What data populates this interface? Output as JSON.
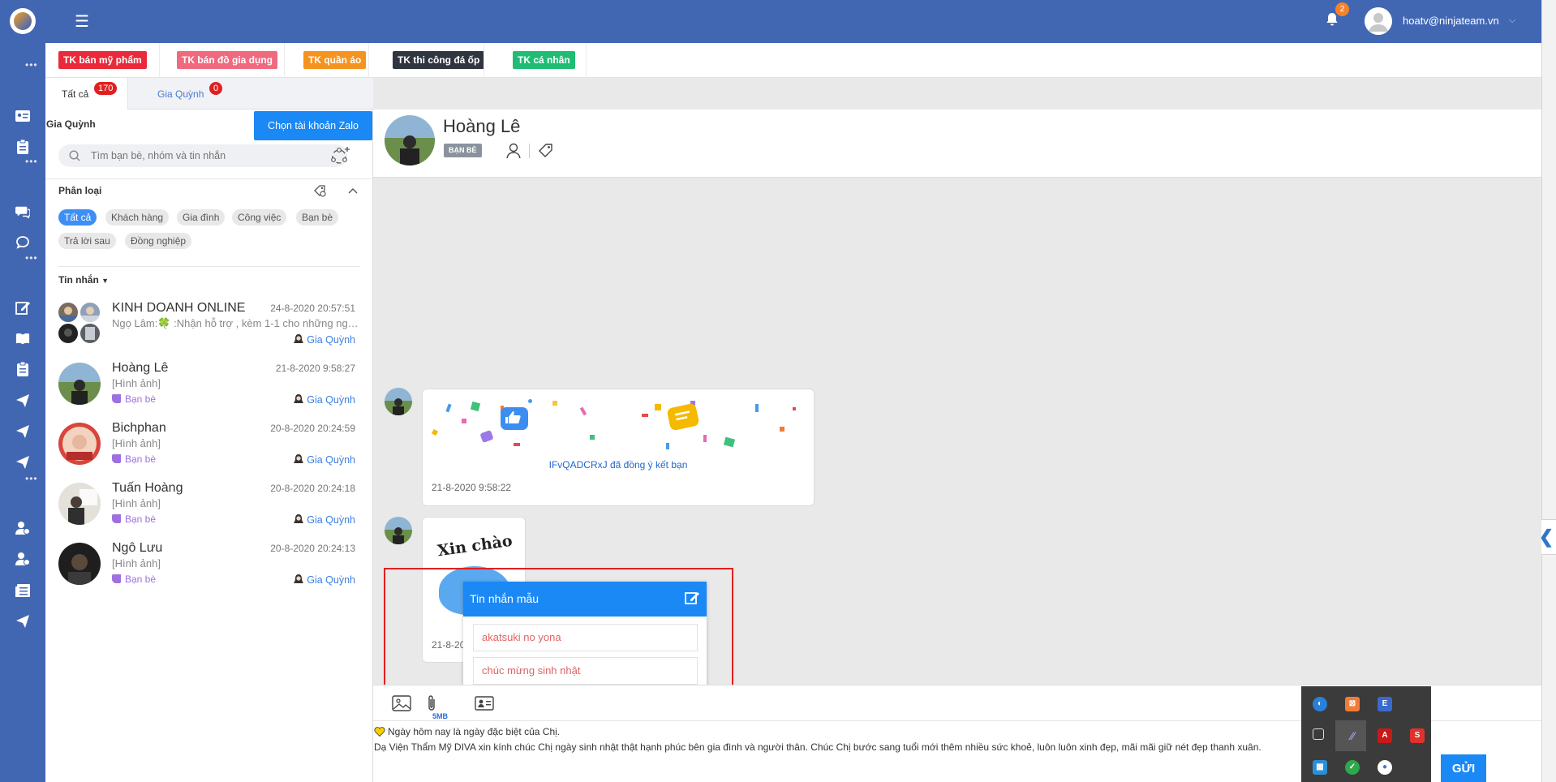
{
  "header": {
    "notification_count": "2",
    "user_email": "hoatv@ninjateam.vn"
  },
  "account_tags": [
    {
      "label": "TK bán mỹ phẩm",
      "color": "#ea2a3a"
    },
    {
      "label": "TK bán đồ gia dụng",
      "color": "#f0697e"
    },
    {
      "label": "TK quần áo",
      "color": "#f6931e"
    },
    {
      "label": "TK thi công đá ốp",
      "color": "#2f3640"
    },
    {
      "label": "TK cá nhân",
      "color": "#1fbd74"
    }
  ],
  "tabs": [
    {
      "label": "Tất cả",
      "count": "170"
    },
    {
      "label": "Gia Quỳnh",
      "count": "0"
    }
  ],
  "sidebar": {
    "account_name": "Gia Quỳnh",
    "choose_account_label": "Chọn tài khoản Zalo",
    "search_placeholder": "Tìm bạn bè, nhóm và tin nhắn",
    "category_title": "Phân loại",
    "categories": [
      "Tất cả",
      "Khách hàng",
      "Gia đình",
      "Công việc",
      "Bạn bè",
      "Trả lời sau",
      "Đồng nghiệp"
    ],
    "messages_title": "Tin nhắn"
  },
  "conversations": [
    {
      "name": "KINH DOANH ONLINE",
      "time": "24-8-2020 20:57:51",
      "message": "Ngọ Lâm:🍀 :Nhận hỗ trợ , kèm 1-1 cho những người ...",
      "label": "",
      "owner": "Gia Quỳnh"
    },
    {
      "name": "Hoàng Lê",
      "time": "21-8-2020 9:58:27",
      "message": "[Hình ảnh]",
      "label": "Bạn bè",
      "owner": "Gia Quỳnh"
    },
    {
      "name": "Bichphan",
      "time": "20-8-2020 20:24:59",
      "message": "[Hình ảnh]",
      "label": "Bạn bè",
      "owner": "Gia Quỳnh"
    },
    {
      "name": "Tuấn Hoàng",
      "time": "20-8-2020 20:24:18",
      "message": "[Hình ảnh]",
      "label": "Bạn bè",
      "owner": "Gia Quỳnh"
    },
    {
      "name": "Ngô Lưu",
      "time": "20-8-2020 20:24:13",
      "message": "[Hình ảnh]",
      "label": "Bạn bè",
      "owner": "Gia Quỳnh"
    }
  ],
  "chat": {
    "contact_name": "Hoàng Lê",
    "contact_badge": "BẠN BÈ",
    "friend_accept_text": "IFvQADCRxJ đã đồng ý kết bạn",
    "friend_accept_time": "21-8-2020 9:58:22",
    "sticker_text": "Xin chào",
    "sticker_time": "21-8-20"
  },
  "template_popup": {
    "title": "Tin nhắn mẫu",
    "items": [
      "akatsuki no yona",
      "chúc mừng sinh nhật"
    ]
  },
  "composer": {
    "file_limit": "5MB",
    "line1": "Ngày hôm nay là ngày đặc biệt của Chị.",
    "line2": "Dạ Viện Thẩm Mỹ DIVA xin kính chúc Chị ngày sinh nhật thật hạnh phúc bên gia đình và người thân. Chúc Chị bước sang tuổi mới thêm nhiều sức khoẻ, luôn luôn xinh đẹp, mãi mãi giữ nét đẹp thanh xuân.",
    "send_label": "GỬI"
  },
  "colors": {
    "brand": "#4267b2",
    "accent": "#1a88f5",
    "highlight_box": "#e02020"
  }
}
